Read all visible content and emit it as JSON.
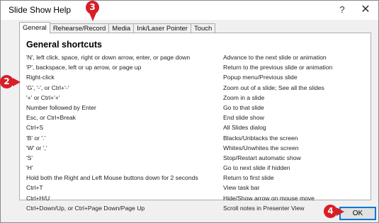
{
  "window": {
    "title": "Slide Show Help",
    "help_glyph": "?",
    "close_glyph": "✕"
  },
  "tabs": [
    {
      "label": "General",
      "active": true
    },
    {
      "label": "Rehearse/Record",
      "active": false
    },
    {
      "label": "Media",
      "active": false
    },
    {
      "label": "Ink/Laser Pointer",
      "active": false
    },
    {
      "label": "Touch",
      "active": false
    }
  ],
  "panel": {
    "heading": "General shortcuts",
    "shortcuts": [
      {
        "key": "'N', left click, space, right or down arrow, enter, or page down",
        "action": "Advance to the next slide or animation"
      },
      {
        "key": "'P', backspace, left or up arrow, or page up",
        "action": "Return to the previous slide or animation"
      },
      {
        "key": "Right-click",
        "action": "Popup menu/Previous slide"
      },
      {
        "key": "'G', '-', or Ctrl+'-'",
        "action": "Zoom out of a slide; See all the slides"
      },
      {
        "key": "'+' or Ctrl+'+'",
        "action": "Zoom in a slide"
      },
      {
        "key": "Number followed by Enter",
        "action": "Go to that slide"
      },
      {
        "key": "Esc, or Ctrl+Break",
        "action": "End slide show"
      },
      {
        "key": "Ctrl+S",
        "action": "All Slides dialog"
      },
      {
        "key": "'B' or '.'",
        "action": "Blacks/Unblacks the screen"
      },
      {
        "key": "'W' or ','",
        "action": "Whites/Unwhites the screen"
      },
      {
        "key": "'S'",
        "action": "Stop/Restart automatic show"
      },
      {
        "key": "'H'",
        "action": "Go to next slide if hidden"
      },
      {
        "key": "Hold both the Right and Left Mouse buttons down for 2 seconds",
        "action": "Return to first slide"
      },
      {
        "key": "Ctrl+T",
        "action": "View task bar"
      },
      {
        "key": "Ctrl+H/U",
        "action": "Hide/Show arrow on mouse move"
      },
      {
        "key": "Ctrl+Down/Up, or Ctrl+Page Down/Page Up",
        "action": "Scroll notes in Presenter View"
      }
    ]
  },
  "ok_button": {
    "label": "OK"
  },
  "callouts": {
    "c2": "2",
    "c3": "3",
    "c4": "4"
  },
  "colors": {
    "callout": "#d81e26",
    "focus_border": "#0078d7"
  }
}
